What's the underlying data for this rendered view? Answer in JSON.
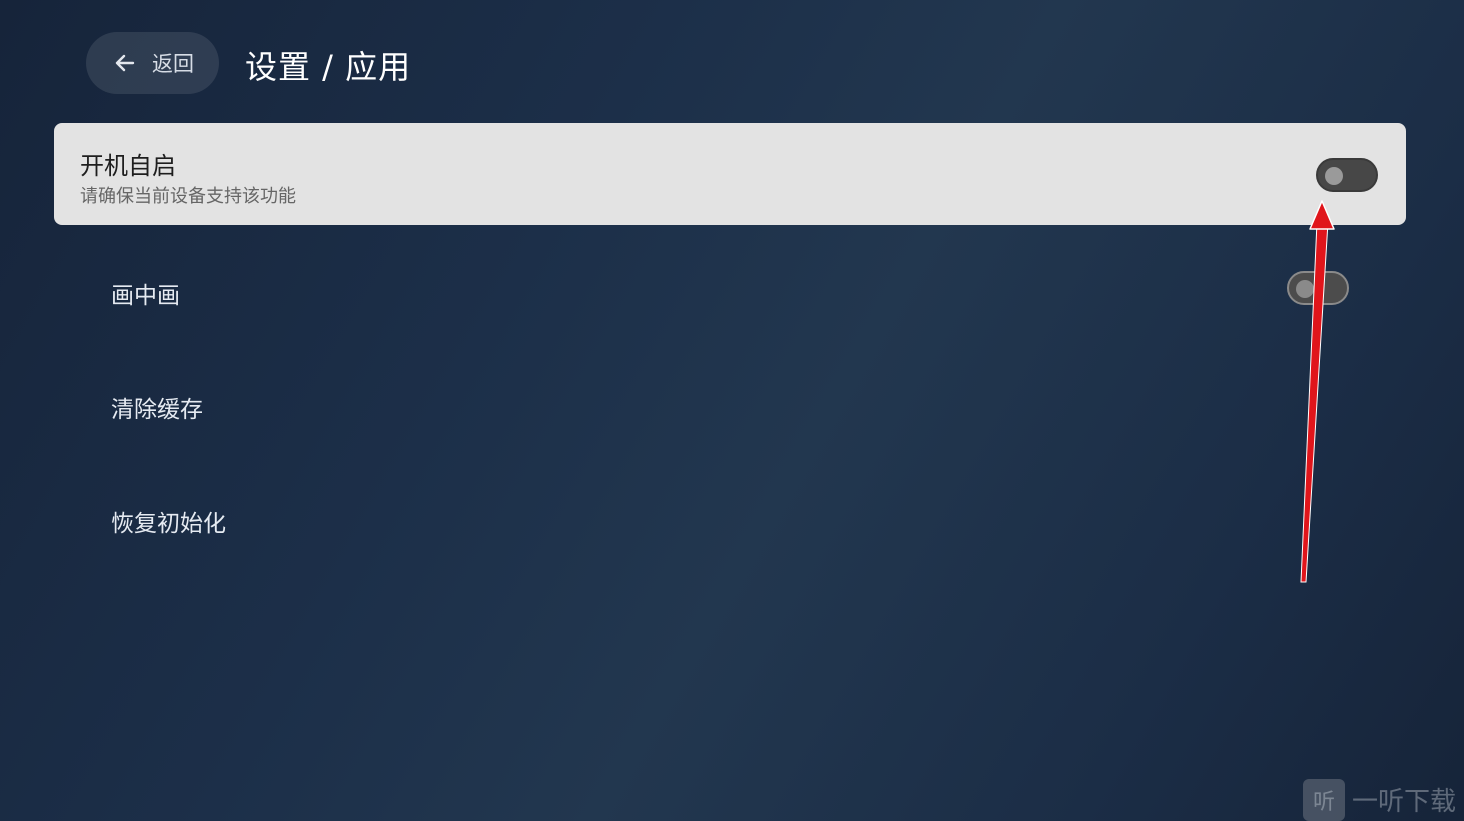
{
  "header": {
    "back_label": "返回",
    "title": "设置 / 应用"
  },
  "settings": {
    "autostart": {
      "title": "开机自启",
      "subtitle": "请确保当前设备支持该功能",
      "toggle_on": false
    },
    "pip": {
      "title": "画中画",
      "toggle_on": false
    },
    "clear_cache": {
      "title": "清除缓存"
    },
    "reset": {
      "title": "恢复初始化"
    }
  },
  "watermark": {
    "logo_text": "听",
    "text": "一听下载"
  },
  "colors": {
    "annotation_arrow": "#e0151b",
    "focused_card": "#e3e3e3"
  },
  "icons": {
    "back": "arrow-left-icon"
  }
}
